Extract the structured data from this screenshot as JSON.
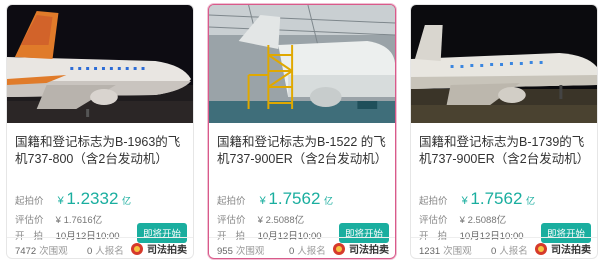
{
  "cards": [
    {
      "title": "国籍和登记标志为B-1963的飞机737-800（含2台发动机）",
      "start_label": "起拍价",
      "currency": "¥",
      "start_price": "1.2332",
      "start_unit": "亿",
      "eval_label": "评估价",
      "eval_price": "¥ 1.7616亿",
      "time_label": "开拍",
      "time_value": "10月12日10:00",
      "badge": "即将开始",
      "views": "7472",
      "views_unit": "次围观",
      "applicants": "0",
      "applicants_unit": "人报名",
      "court": "司法拍卖"
    },
    {
      "title": "国籍和登记标志为B-1522 的飞机737-900ER（含2台发动机）",
      "start_label": "起拍价",
      "currency": "¥",
      "start_price": "1.7562",
      "start_unit": "亿",
      "eval_label": "评估价",
      "eval_price": "¥ 2.5088亿",
      "time_label": "开拍",
      "time_value": "10月12日10:00",
      "badge": "即将开始",
      "views": "955",
      "views_unit": "次围观",
      "applicants": "0",
      "applicants_unit": "人报名",
      "court": "司法拍卖"
    },
    {
      "title": "国籍和登记标志为B-1739的飞机737-900ER（含2台发动机）",
      "start_label": "起拍价",
      "currency": "¥",
      "start_price": "1.7562",
      "start_unit": "亿",
      "eval_label": "评估价",
      "eval_price": "¥ 2.5088亿",
      "time_label": "开拍",
      "time_value": "10月12日10:00",
      "badge": "即将开始",
      "views": "1231",
      "views_unit": "次围观",
      "applicants": "0",
      "applicants_unit": "人报名",
      "court": "司法拍卖"
    }
  ],
  "colors": {
    "accent": "#1aae9f",
    "active_border": "#d95a8a",
    "court_emblem": "#d63a2b"
  }
}
